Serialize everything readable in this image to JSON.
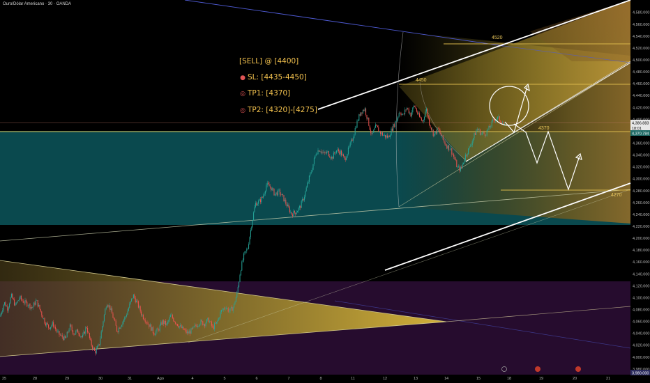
{
  "header": {
    "symbol_title": "Ouro/Dólar Americano · 30 · OANDA"
  },
  "signal": {
    "line1": "[SELL] @ [4400]",
    "line2": "SL: [4435-4450]",
    "line3": "TP1: [4370]",
    "line4": "TP2: [4320]-[4275]",
    "icon_sl": "stop-pin-icon",
    "icon_tp": "target-icon"
  },
  "levels": {
    "l4520": "4520",
    "l4450": "4450",
    "l4370": "4370",
    "l4270": "4270"
  },
  "price_tags": {
    "current": "4,386.883",
    "countdown": "18:01",
    "support": "4,370.784",
    "last_axis": "3,980.000"
  },
  "colors": {
    "background": "#000000",
    "up_candle": "#26a69a",
    "down_candle": "#ef5350",
    "teal_zone": "#0b4f55",
    "purple_zone": "#2a0d33",
    "level_line": "#d8b64a",
    "channel_line": "#ffffff",
    "projection_path": "#ffffff"
  },
  "chart_data": {
    "type": "candlestick",
    "symbol": "Ouro/Dólar Americano",
    "timeframe": "30",
    "source": "OANDA",
    "x_tick_labels": [
      "25",
      "28",
      "29",
      "30",
      "31",
      "Ago",
      "4",
      "5",
      "6",
      "7",
      "8",
      "11",
      "12",
      "13",
      "14",
      "15",
      "18",
      "19",
      "20",
      "21"
    ],
    "y_ticks": [
      3980,
      4000,
      4020,
      4040,
      4060,
      4080,
      4100,
      4120,
      4140,
      4160,
      4180,
      4200,
      4220,
      4240,
      4260,
      4280,
      4300,
      4320,
      4340,
      4360,
      4380,
      4400,
      4420,
      4440,
      4460,
      4480,
      4500,
      4520,
      4540,
      4560,
      4580
    ],
    "ylim": [
      3974,
      4589
    ],
    "price_path": [
      {
        "x": 0,
        "y": 4068
      },
      {
        "x": 6,
        "y": 4092
      },
      {
        "x": 11,
        "y": 4082
      },
      {
        "x": 16,
        "y": 4103
      },
      {
        "x": 22,
        "y": 4087
      },
      {
        "x": 28,
        "y": 4100
      },
      {
        "x": 34,
        "y": 4093
      },
      {
        "x": 40,
        "y": 4089
      },
      {
        "x": 46,
        "y": 4083
      },
      {
        "x": 52,
        "y": 4095
      },
      {
        "x": 58,
        "y": 4078
      },
      {
        "x": 64,
        "y": 4060
      },
      {
        "x": 70,
        "y": 4050
      },
      {
        "x": 76,
        "y": 4056
      },
      {
        "x": 82,
        "y": 4041
      },
      {
        "x": 88,
        "y": 4035
      },
      {
        "x": 94,
        "y": 4030
      },
      {
        "x": 100,
        "y": 4052
      },
      {
        "x": 106,
        "y": 4040
      },
      {
        "x": 112,
        "y": 4044
      },
      {
        "x": 118,
        "y": 4032
      },
      {
        "x": 124,
        "y": 4052
      },
      {
        "x": 130,
        "y": 4024
      },
      {
        "x": 136,
        "y": 4008
      },
      {
        "x": 142,
        "y": 4020
      },
      {
        "x": 148,
        "y": 4062
      },
      {
        "x": 153,
        "y": 4093
      },
      {
        "x": 158,
        "y": 4082
      },
      {
        "x": 163,
        "y": 4064
      },
      {
        "x": 168,
        "y": 4044
      },
      {
        "x": 174,
        "y": 4056
      },
      {
        "x": 180,
        "y": 4068
      },
      {
        "x": 186,
        "y": 4088
      },
      {
        "x": 191,
        "y": 4104
      },
      {
        "x": 197,
        "y": 4090
      },
      {
        "x": 203,
        "y": 4072
      },
      {
        "x": 209,
        "y": 4062
      },
      {
        "x": 215,
        "y": 4052
      },
      {
        "x": 221,
        "y": 4040
      },
      {
        "x": 227,
        "y": 4046
      },
      {
        "x": 233,
        "y": 4060
      },
      {
        "x": 239,
        "y": 4054
      },
      {
        "x": 245,
        "y": 4070
      },
      {
        "x": 251,
        "y": 4060
      },
      {
        "x": 257,
        "y": 4052
      },
      {
        "x": 263,
        "y": 4046
      },
      {
        "x": 269,
        "y": 4040
      },
      {
        "x": 275,
        "y": 4045
      },
      {
        "x": 281,
        "y": 4053
      },
      {
        "x": 287,
        "y": 4059
      },
      {
        "x": 293,
        "y": 4056
      },
      {
        "x": 299,
        "y": 4063
      },
      {
        "x": 305,
        "y": 4049
      },
      {
        "x": 311,
        "y": 4058
      },
      {
        "x": 317,
        "y": 4077
      },
      {
        "x": 323,
        "y": 4085
      },
      {
        "x": 329,
        "y": 4077
      },
      {
        "x": 335,
        "y": 4085
      },
      {
        "x": 340,
        "y": 4108
      },
      {
        "x": 345,
        "y": 4148
      },
      {
        "x": 350,
        "y": 4172
      },
      {
        "x": 355,
        "y": 4182
      },
      {
        "x": 360,
        "y": 4218
      },
      {
        "x": 366,
        "y": 4258
      },
      {
        "x": 372,
        "y": 4262
      },
      {
        "x": 377,
        "y": 4270
      },
      {
        "x": 382,
        "y": 4290
      },
      {
        "x": 388,
        "y": 4286
      },
      {
        "x": 394,
        "y": 4274
      },
      {
        "x": 400,
        "y": 4278
      },
      {
        "x": 406,
        "y": 4268
      },
      {
        "x": 412,
        "y": 4254
      },
      {
        "x": 418,
        "y": 4241
      },
      {
        "x": 424,
        "y": 4244
      },
      {
        "x": 430,
        "y": 4252
      },
      {
        "x": 436,
        "y": 4270
      },
      {
        "x": 442,
        "y": 4296
      },
      {
        "x": 448,
        "y": 4320
      },
      {
        "x": 453,
        "y": 4344
      },
      {
        "x": 458,
        "y": 4350
      },
      {
        "x": 464,
        "y": 4342
      },
      {
        "x": 470,
        "y": 4344
      },
      {
        "x": 476,
        "y": 4335
      },
      {
        "x": 482,
        "y": 4348
      },
      {
        "x": 488,
        "y": 4345
      },
      {
        "x": 494,
        "y": 4332
      },
      {
        "x": 500,
        "y": 4350
      },
      {
        "x": 506,
        "y": 4370
      },
      {
        "x": 511,
        "y": 4392
      },
      {
        "x": 517,
        "y": 4412
      },
      {
        "x": 523,
        "y": 4418
      },
      {
        "x": 528,
        "y": 4396
      },
      {
        "x": 533,
        "y": 4372
      },
      {
        "x": 539,
        "y": 4388
      },
      {
        "x": 545,
        "y": 4378
      },
      {
        "x": 551,
        "y": 4372
      },
      {
        "x": 557,
        "y": 4370
      },
      {
        "x": 562,
        "y": 4384
      },
      {
        "x": 568,
        "y": 4398
      },
      {
        "x": 573,
        "y": 4414
      },
      {
        "x": 578,
        "y": 4406
      },
      {
        "x": 583,
        "y": 4420
      },
      {
        "x": 589,
        "y": 4408
      },
      {
        "x": 594,
        "y": 4424
      },
      {
        "x": 600,
        "y": 4406
      },
      {
        "x": 606,
        "y": 4396
      },
      {
        "x": 611,
        "y": 4418
      },
      {
        "x": 616,
        "y": 4392
      },
      {
        "x": 622,
        "y": 4374
      },
      {
        "x": 628,
        "y": 4384
      },
      {
        "x": 634,
        "y": 4368
      },
      {
        "x": 640,
        "y": 4356
      },
      {
        "x": 646,
        "y": 4350
      },
      {
        "x": 651,
        "y": 4336
      },
      {
        "x": 656,
        "y": 4318
      },
      {
        "x": 661,
        "y": 4316
      },
      {
        "x": 667,
        "y": 4338
      },
      {
        "x": 673,
        "y": 4352
      },
      {
        "x": 679,
        "y": 4370
      },
      {
        "x": 684,
        "y": 4384
      },
      {
        "x": 690,
        "y": 4376
      },
      {
        "x": 696,
        "y": 4376
      },
      {
        "x": 702,
        "y": 4386
      },
      {
        "x": 708,
        "y": 4400
      },
      {
        "x": 714,
        "y": 4402
      },
      {
        "x": 720,
        "y": 4396
      },
      {
        "x": 724,
        "y": 4387
      }
    ]
  }
}
